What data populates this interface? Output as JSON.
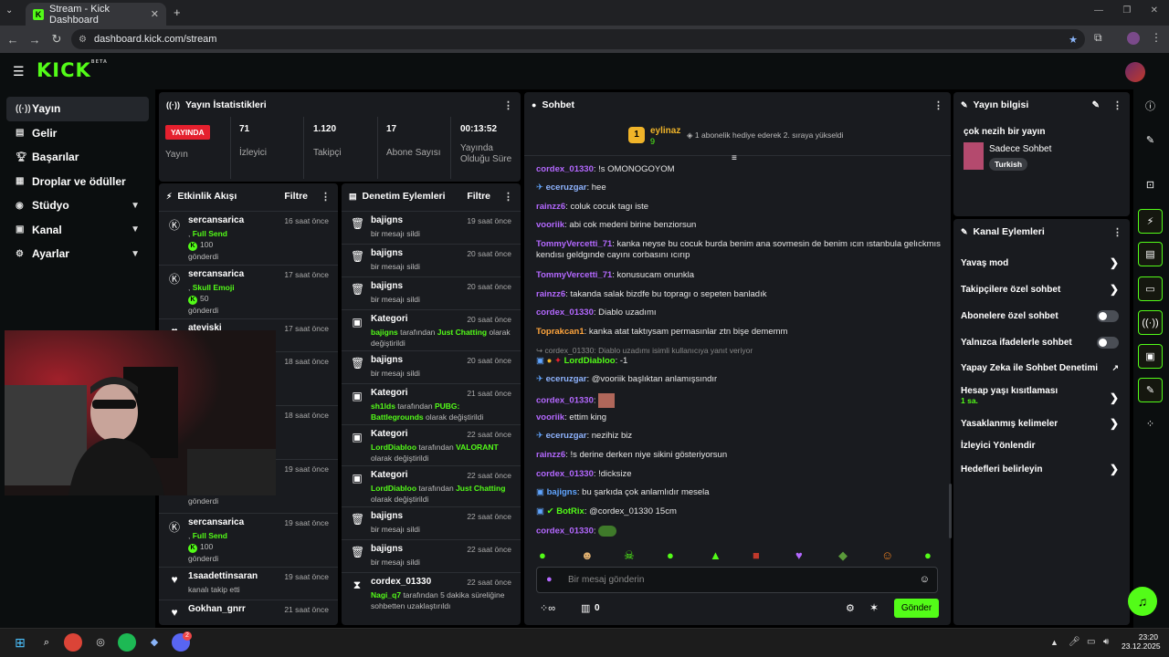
{
  "browser": {
    "tab_title": "Stream - Kick Dashboard",
    "url": "dashboard.kick.com/stream"
  },
  "brand": {
    "logo": "KICK",
    "beta": "BETA",
    "accent": "#53fc18"
  },
  "sidebar": {
    "items": [
      {
        "label": "Yayın",
        "icon": "broadcast-icon"
      },
      {
        "label": "Gelir",
        "icon": "revenue-icon"
      },
      {
        "label": "Başarılar",
        "icon": "trophy-icon"
      },
      {
        "label": "Droplar ve ödüller",
        "icon": "gift-icon"
      },
      {
        "label": "Stüdyo",
        "icon": "studio-icon"
      },
      {
        "label": "Kanal",
        "icon": "channel-icon"
      },
      {
        "label": "Ayarlar",
        "icon": "gear-icon"
      }
    ]
  },
  "stats": {
    "title": "Yayın İstatistikleri",
    "live_badge": "YAYINDA",
    "live_label": "Yayın",
    "viewers": {
      "value": "71",
      "label": "İzleyici"
    },
    "followers": {
      "value": "1.120",
      "label": "Takipçi"
    },
    "subs": {
      "value": "17",
      "label": "Abone Sayısı"
    },
    "uptime": {
      "value": "00:13:52",
      "label": "Yayında Olduğu Süre"
    }
  },
  "activity": {
    "title": "Etkinlik Akışı",
    "filter": "Filtre",
    "rows": [
      {
        "name": "sercansarica",
        "time": "16 saat önce",
        "action": "Full Send",
        "amount": "100",
        "verb": "gönderdi"
      },
      {
        "name": "sercansarica",
        "time": "17 saat önce",
        "action": "Skull Emoji",
        "amount": "50",
        "verb": "gönderdi"
      },
      {
        "name": "ateviski",
        "time": "17 saat önce"
      },
      {
        "time": "18 saat önce"
      },
      {
        "time": "18 saat önce"
      },
      {
        "time": "19 saat önce",
        "amount": "100",
        "verb": "gönderdi"
      },
      {
        "name": "sercansarica",
        "time": "19 saat önce",
        "action": "Full Send",
        "amount": "100",
        "verb": "gönderdi"
      },
      {
        "name": "1saadettinsaran",
        "time": "19 saat önce",
        "sub": "kanalı takip etti"
      },
      {
        "name": "Gokhan_gnrr",
        "time": "21 saat önce"
      }
    ]
  },
  "moderation": {
    "title": "Denetim Eylemleri",
    "filter": "Filtre",
    "rows": [
      {
        "name": "bajigns",
        "time": "19 saat önce",
        "sub": "bir mesajı sildi"
      },
      {
        "name": "bajigns",
        "time": "20 saat önce",
        "sub": "bir mesajı sildi"
      },
      {
        "name": "bajigns",
        "time": "20 saat önce",
        "sub": "bir mesajı sildi"
      },
      {
        "name": "Kategori",
        "time": "20 saat önce",
        "by": "bajigns",
        "mid": " tarafından ",
        "target": "Just Chatting",
        "tail": " olarak değiştirildi"
      },
      {
        "name": "bajigns",
        "time": "20 saat önce",
        "sub": "bir mesajı sildi"
      },
      {
        "name": "Kategori",
        "time": "21 saat önce",
        "by": "sh1lds",
        "mid": " tarafından ",
        "target": "PUBG: Battlegrounds",
        "tail": " olarak değiştirildi"
      },
      {
        "name": "Kategori",
        "time": "22 saat önce",
        "by": "LordDiabloo",
        "mid": " tarafından ",
        "target": "VALORANT",
        "tail": " olarak değiştirildi"
      },
      {
        "name": "Kategori",
        "time": "22 saat önce",
        "by": "LordDiabloo",
        "mid": " tarafından ",
        "target": "Just Chatting",
        "tail": " olarak değiştirildi"
      },
      {
        "name": "bajigns",
        "time": "22 saat önce",
        "sub": "bir mesajı sildi"
      },
      {
        "name": "bajigns",
        "time": "22 saat önce",
        "sub": "bir mesajı sildi"
      },
      {
        "name": "cordex_01330",
        "time": "22 saat önce",
        "by": "Nagi_q7",
        "mid": " tarafından 5 dakika süreliğine sohbetten uzaklaştırıldı",
        "target": "",
        "tail": ""
      }
    ]
  },
  "chat": {
    "title": "Sohbet",
    "gifter": {
      "name": "eylinaz",
      "rank": "1",
      "count": "9",
      "note": "1 abonelik hediye ederek 2. sıraya yükseldi"
    },
    "messages": [
      {
        "user": "cordex_01330",
        "text": ": !s OMONOGOYOM",
        "color": "u-g"
      },
      {
        "user": "eceruzgar",
        "text": ": hee",
        "color": "u-b"
      },
      {
        "user": "rainzz6",
        "text": ": coluk cocuk tagı iste",
        "color": "u-g"
      },
      {
        "user": "vooriik",
        "text": ": abi cok medeni birine benziorsun",
        "color": "u-g"
      },
      {
        "user": "TommyVercetti_71",
        "text": ": kanka neyse bu cocuk burda benim ana sovmesin de benim ıcın ıstanbula gelıckmıs kendısı geldgınde cayını corbasını ıcırıp",
        "color": "u-g"
      },
      {
        "user": "TommyVercetti_71",
        "text": ": konusucam onunkla",
        "color": "u-g"
      },
      {
        "user": "rainzz6",
        "text": ": takanda salak bizdfe bu topragı o sepeten banladık",
        "color": "u-g"
      },
      {
        "user": "cordex_01330",
        "text": ": Diablo uzadımı",
        "color": "u-g"
      },
      {
        "user": "Toprakcan1",
        "text": ": kanka atat taktıysam permasınlar ztn bişe dememm",
        "color": "u-o"
      },
      {
        "reply": "cordex_01330: Diablo uzadımı isimli kullanıcıya yanıt veriyor"
      },
      {
        "user": "LordDiabloo",
        "text": ": -1",
        "color": "u-gr"
      },
      {
        "user": "eceruzgar",
        "text": ": @vooriik başlıktan anlamışsındır",
        "color": "u-b"
      },
      {
        "user": "cordex_01330",
        "text": ":",
        "color": "u-g"
      },
      {
        "user": "vooriik",
        "text": ": ettim king",
        "color": "u-g"
      },
      {
        "user": "eceruzgar",
        "text": ": nezihiz biz",
        "color": "u-b"
      },
      {
        "user": "rainzz6",
        "text": ": !s derine derken niye sikini gösteriyorsun",
        "color": "u-g"
      },
      {
        "user": "cordex_01330",
        "text": ": !dicksize",
        "color": "u-g"
      },
      {
        "user": "bajigns",
        "text": ": bu şarkıda çok anlamlıdır mesela",
        "color": "u-bl"
      },
      {
        "user": "BotRix",
        "text": ": @cordex_01330 15cm",
        "color": "u-gr"
      },
      {
        "user": "cordex_01330",
        "text": ":",
        "color": "u-g"
      }
    ],
    "input_placeholder": "Bir mesaj gönderin",
    "points": "0",
    "send_label": "Gönder"
  },
  "stream_info": {
    "title": "Yayın bilgisi",
    "stream_title": "çok nezih bir yayın",
    "category": "Sadece Sohbet",
    "tag": "Turkish"
  },
  "channel_actions": {
    "title": "Kanal Eylemleri",
    "items": [
      {
        "label": "Yavaş mod",
        "kind": "chevron"
      },
      {
        "label": "Takipçilere özel sohbet",
        "kind": "chevron"
      },
      {
        "label": "Abonelere özel sohbet",
        "kind": "toggle"
      },
      {
        "label": "Yalnızca ifadelerle sohbet",
        "kind": "toggle"
      },
      {
        "label": "Yapay Zeka ile Sohbet Denetimi",
        "kind": "external"
      },
      {
        "label": "Hesap yaşı kısıtlaması",
        "sub": "1 sa.",
        "kind": "chevron"
      },
      {
        "label": "Yasaklanmış kelimeler",
        "kind": "chevron"
      },
      {
        "label": "İzleyici Yönlendir",
        "kind": "none"
      },
      {
        "label": "Hedefleri belirleyin",
        "kind": "chevron"
      }
    ]
  },
  "taskbar": {
    "time": "23:20",
    "date": "23.12.2025",
    "badge": "2"
  }
}
